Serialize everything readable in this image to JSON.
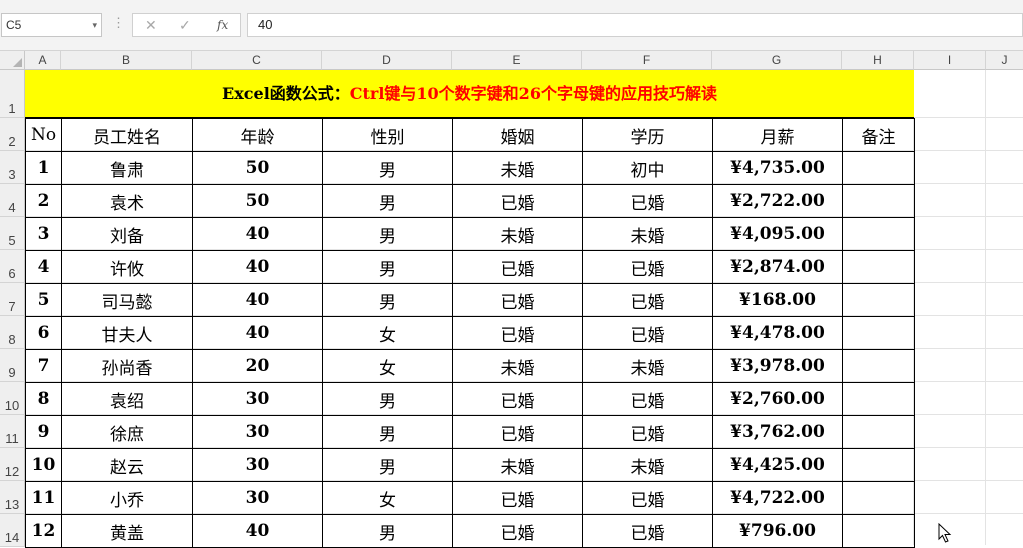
{
  "formula_bar": {
    "name_box": "C5",
    "name_box_dropdown": "▾",
    "separator": "⋮",
    "cancel_icon": "✕",
    "enter_icon": "✓",
    "fx_label": "fx",
    "formula": "40"
  },
  "columns": [
    "A",
    "B",
    "C",
    "D",
    "E",
    "F",
    "G",
    "H",
    "I",
    "J"
  ],
  "rows": [
    "1",
    "2",
    "3",
    "4",
    "5",
    "6",
    "7",
    "8",
    "9",
    "10",
    "11",
    "12",
    "13",
    "14"
  ],
  "sheet": {
    "title_black": "Excel函数公式：",
    "title_red": "Ctrl键与10个数字键和26个字母键的应用技巧解读",
    "headers": [
      "No",
      "员工姓名",
      "年龄",
      "性别",
      "婚姻",
      "学历",
      "月薪",
      "备注"
    ],
    "data": [
      [
        "1",
        "鲁肃",
        "50",
        "男",
        "未婚",
        "初中",
        "¥4,735.00",
        ""
      ],
      [
        "2",
        "袁术",
        "50",
        "男",
        "已婚",
        "已婚",
        "¥2,722.00",
        ""
      ],
      [
        "3",
        "刘备",
        "40",
        "男",
        "未婚",
        "未婚",
        "¥4,095.00",
        ""
      ],
      [
        "4",
        "许攸",
        "40",
        "男",
        "已婚",
        "已婚",
        "¥2,874.00",
        ""
      ],
      [
        "5",
        "司马懿",
        "40",
        "男",
        "已婚",
        "已婚",
        "¥168.00",
        ""
      ],
      [
        "6",
        "甘夫人",
        "40",
        "女",
        "已婚",
        "已婚",
        "¥4,478.00",
        ""
      ],
      [
        "7",
        "孙尚香",
        "20",
        "女",
        "未婚",
        "未婚",
        "¥3,978.00",
        ""
      ],
      [
        "8",
        "袁绍",
        "30",
        "男",
        "已婚",
        "已婚",
        "¥2,760.00",
        ""
      ],
      [
        "9",
        "徐庶",
        "30",
        "男",
        "已婚",
        "已婚",
        "¥3,762.00",
        ""
      ],
      [
        "10",
        "赵云",
        "30",
        "男",
        "未婚",
        "未婚",
        "¥4,425.00",
        ""
      ],
      [
        "11",
        "小乔",
        "30",
        "女",
        "已婚",
        "已婚",
        "¥4,722.00",
        ""
      ],
      [
        "12",
        "黄盖",
        "40",
        "男",
        "已婚",
        "已婚",
        "¥796.00",
        ""
      ]
    ]
  },
  "colors": {
    "title_bg": "#ffff00",
    "title_accent": "#ff0000"
  }
}
